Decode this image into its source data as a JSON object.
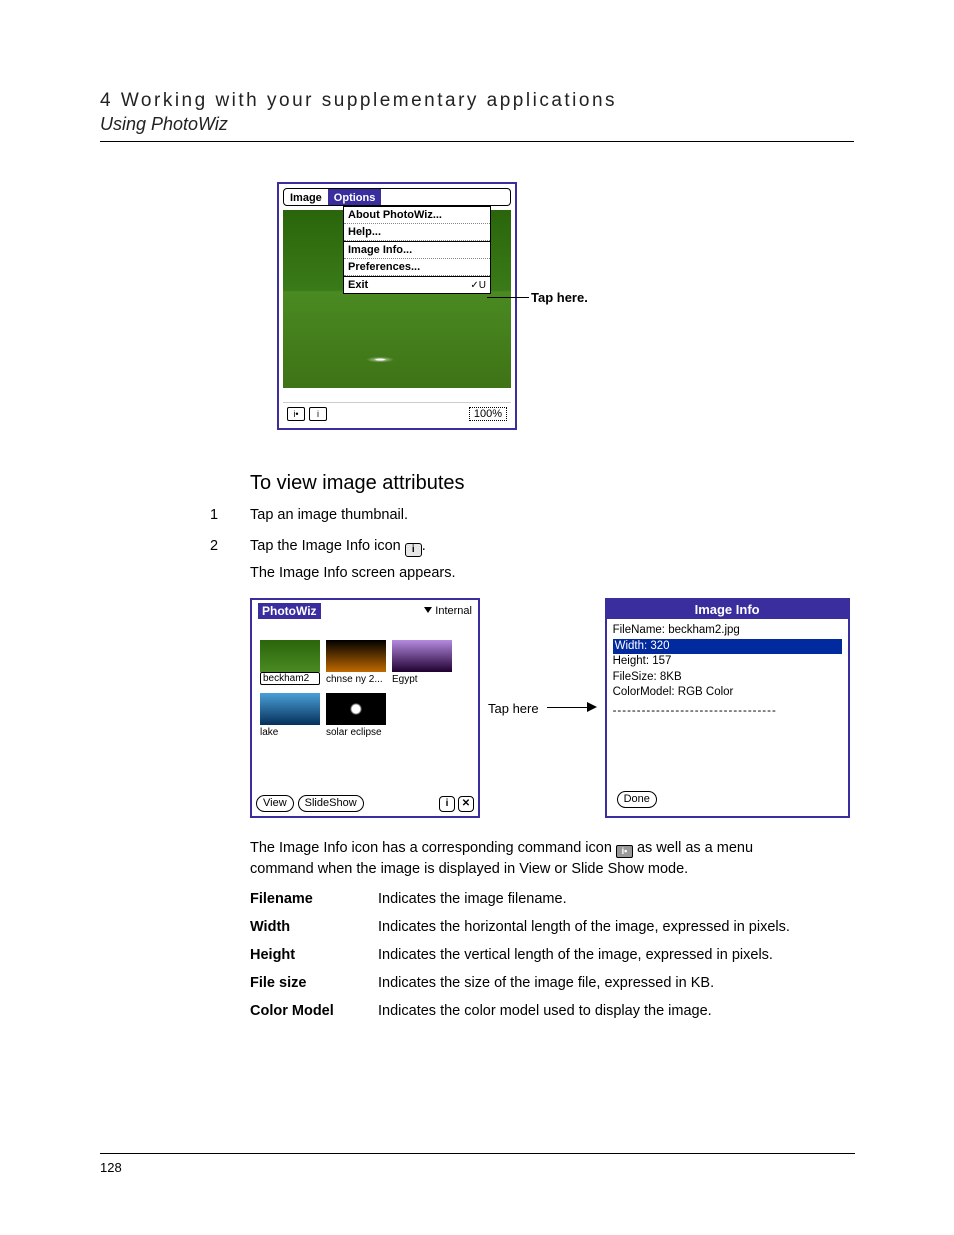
{
  "header": {
    "chapter": "4 Working with your supplementary applications",
    "section": "Using PhotoWiz"
  },
  "fig1": {
    "menu": {
      "image": "Image",
      "options": "Options"
    },
    "dropdown": {
      "about": "About PhotoWiz...",
      "help": "Help...",
      "imageinfo": "Image Info...",
      "prefs": "Preferences...",
      "exit": "Exit",
      "shortcut": "✓U"
    },
    "zoom": "100%",
    "callout": "Tap here."
  },
  "section_title": "To view image attributes",
  "steps": {
    "s1": "Tap an image thumbnail.",
    "s2a": "Tap the Image Info icon ",
    "s2b": ".",
    "s2_sub": "The Image Info screen appears."
  },
  "palm2": {
    "app": "PhotoWiz",
    "storage": "Internal",
    "thumbs": [
      "beckham2",
      "chnse ny 2...",
      "Egypt",
      "lake",
      "solar eclipse"
    ],
    "view": "View",
    "slideshow": "SlideShow",
    "callout": "Tap here"
  },
  "dialog": {
    "title": "Image Info",
    "filename_label": "FileName: ",
    "filename_value": "beckham2.jpg",
    "width": "Width: 320",
    "height": "Height: 157",
    "filesize": "FileSize: 8KB",
    "colormodel": "ColorModel: RGB Color",
    "done": "Done"
  },
  "body_text_a": "The Image Info icon has a corresponding command icon ",
  "body_text_b": " as well as a menu command when the image is displayed in View or Slide Show mode.",
  "defs": {
    "filename": {
      "t": "Filename",
      "d": "Indicates the image filename."
    },
    "width": {
      "t": "Width",
      "d": "Indicates the horizontal length of the image, expressed in pixels."
    },
    "height": {
      "t": "Height",
      "d": "Indicates the vertical length of the image, expressed in pixels."
    },
    "filesize": {
      "t": "File size",
      "d": "Indicates the size of the image file, expressed in KB."
    },
    "cmodel": {
      "t": "Color Model",
      "d": "Indicates the color model used to display the image."
    }
  },
  "page_number": "128"
}
